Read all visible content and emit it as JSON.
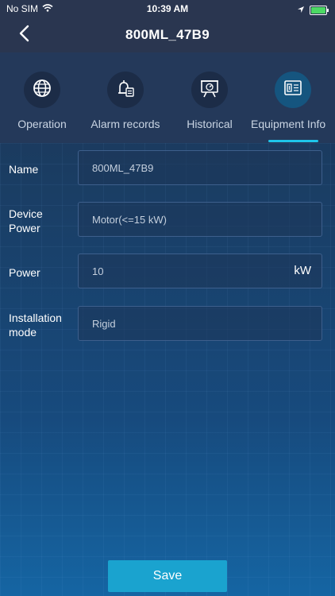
{
  "status_bar": {
    "carrier": "No SIM",
    "time": "10:39 AM"
  },
  "header": {
    "title": "800ML_47B9",
    "back_icon": "chevron-left-icon"
  },
  "tabs": [
    {
      "label": "Operation",
      "icon": "globe-icon"
    },
    {
      "label": "Alarm records",
      "icon": "alarm-bell-icon"
    },
    {
      "label": "Historical",
      "icon": "gauge-board-icon"
    },
    {
      "label": "Equipment Info",
      "icon": "device-panel-icon",
      "active": true
    }
  ],
  "form": {
    "fields": [
      {
        "label": "Name",
        "value": "800ML_47B9"
      },
      {
        "label": "Device Power",
        "value": "Motor(<=15 kW)"
      },
      {
        "label": "Power",
        "value": "10",
        "unit": "kW"
      },
      {
        "label": "Installation mode",
        "value": "Rigid"
      }
    ]
  },
  "actions": {
    "save_label": "Save"
  },
  "colors": {
    "accent": "#1ec6ea",
    "save_button": "#1aa3cf",
    "header_bg": "#2a3650"
  }
}
